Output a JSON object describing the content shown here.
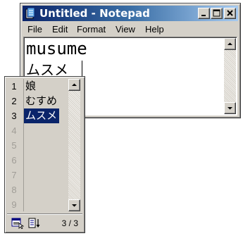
{
  "window": {
    "title": "Untitled - Notepad",
    "menu": [
      "File",
      "Edit",
      "Format",
      "View",
      "Help"
    ]
  },
  "editor": {
    "line1": "musume",
    "line2": "ムスメ"
  },
  "candidates": {
    "rows": [
      {
        "num": "1",
        "text": "娘"
      },
      {
        "num": "2",
        "text": "むすめ"
      },
      {
        "num": "3",
        "text": "ムスメ"
      },
      {
        "num": "4",
        "text": ""
      },
      {
        "num": "5",
        "text": ""
      },
      {
        "num": "6",
        "text": ""
      },
      {
        "num": "7",
        "text": ""
      },
      {
        "num": "8",
        "text": ""
      },
      {
        "num": "9",
        "text": ""
      }
    ],
    "selected_index": 2,
    "counter": "3 / 3"
  },
  "colors": {
    "selection": "#0a246a",
    "titlebar_start": "#0a246a",
    "titlebar_end": "#a6caf0",
    "face": "#d4d0c8"
  },
  "icons": {
    "app": "notepad-icon",
    "minimize": "minimize-icon",
    "maximize": "maximize-icon",
    "close": "close-icon",
    "footer_left": "candidate-list-icon",
    "footer_right": "sort-icon"
  }
}
